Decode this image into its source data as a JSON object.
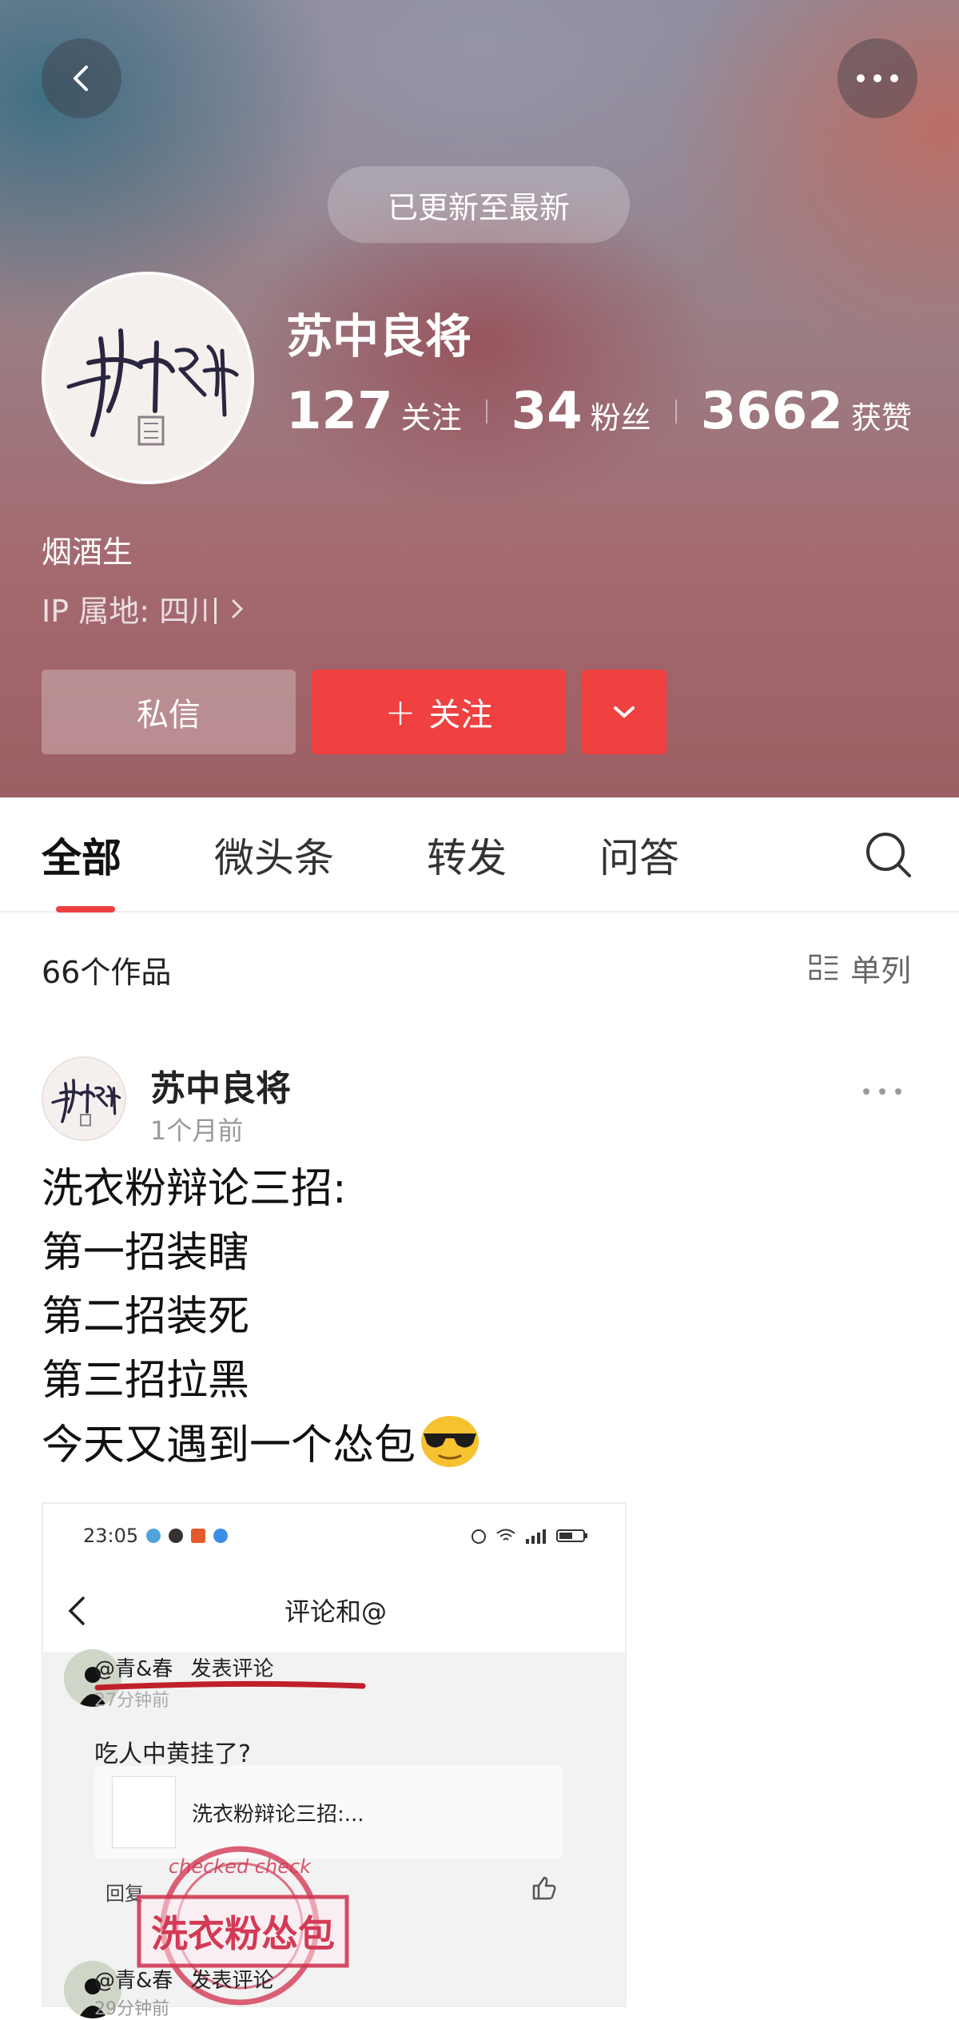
{
  "header": {
    "updated_label": "已更新至最新",
    "name": "苏中良将",
    "stats": [
      {
        "value": "127",
        "label": "关注"
      },
      {
        "value": "34",
        "label": "粉丝"
      },
      {
        "value": "3662",
        "label": "获赞"
      }
    ],
    "signature": "烟酒生",
    "ip_location": "IP 属地: 四川",
    "message_label": "私信",
    "follow_label": "关注",
    "follow_plus": "+"
  },
  "tabs": [
    {
      "label": "全部",
      "active": true
    },
    {
      "label": "微头条",
      "active": false
    },
    {
      "label": "转发",
      "active": false
    },
    {
      "label": "问答",
      "active": false
    }
  ],
  "works": {
    "count_label": "66个作品",
    "layout_label": "单列"
  },
  "post": {
    "author": "苏中良将",
    "time": "1个月前",
    "lines": [
      "洗衣粉辩论三招:",
      "第一招装瞎",
      "第二招装死",
      "第三招拉黑",
      "今天又遇到一个怂包"
    ]
  },
  "embedded_screenshot": {
    "status_time": "23:05",
    "title": "评论和@",
    "comment_user": "@青&春",
    "comment_action": "发表评论",
    "comment_time": "27分钟前",
    "comment_text": "吃人中黄挂了?",
    "card_text": "洗衣粉辩论三招:...",
    "reply_label": "回复",
    "stamp_text": "洗衣粉怂包",
    "stamp_ring_text": "checked check",
    "second_user": "@青&春",
    "second_action": "发表评论",
    "second_time": "29分钟前"
  },
  "colors": {
    "accent_red": "#f04040",
    "text_dark": "#111111",
    "text_muted": "#999999"
  }
}
